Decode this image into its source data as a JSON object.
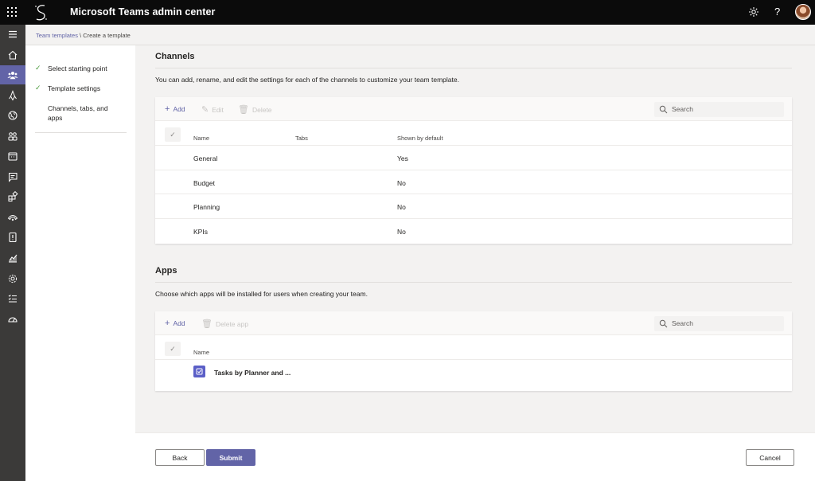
{
  "header": {
    "app_title": "Microsoft Teams admin center",
    "help_label": "?"
  },
  "breadcrumb": {
    "parent": "Team templates",
    "separator": " \\ ",
    "current": "Create a template"
  },
  "steps": [
    {
      "label": "Select starting point",
      "completed": true
    },
    {
      "label": "Template settings",
      "completed": true
    },
    {
      "label": "Channels, tabs, and apps",
      "completed": false
    }
  ],
  "channels": {
    "title": "Channels",
    "description": "You can add, rename, and edit the settings for each of the channels to customize your team template.",
    "toolbar": {
      "add": "Add",
      "edit": "Edit",
      "delete": "Delete",
      "search_placeholder": "Search"
    },
    "columns": [
      "Name",
      "Tabs",
      "Shown by default"
    ],
    "rows": [
      {
        "name": "General",
        "tabs": "",
        "shown": "Yes"
      },
      {
        "name": "Budget",
        "tabs": "",
        "shown": "No"
      },
      {
        "name": "Planning",
        "tabs": "",
        "shown": "No"
      },
      {
        "name": "KPIs",
        "tabs": "",
        "shown": "No"
      }
    ]
  },
  "apps": {
    "title": "Apps",
    "description": "Choose which apps will be installed for users when creating your team.",
    "toolbar": {
      "add": "Add",
      "delete": "Delete app",
      "search_placeholder": "Search"
    },
    "columns": [
      "Name"
    ],
    "rows": [
      {
        "name": "Tasks by Planner and ...",
        "icon": "planner-icon"
      }
    ]
  },
  "footer": {
    "back": "Back",
    "submit": "Submit",
    "cancel": "Cancel"
  },
  "rail_icons": [
    "menu-icon",
    "home-icon",
    "teams-icon",
    "deploy-icon",
    "globe-icon",
    "users-icon",
    "meetings-icon",
    "messaging-icon",
    "apps-icon",
    "voice-icon",
    "policy-icon",
    "analytics-icon",
    "settings-icon",
    "planning-icon",
    "dashboard-icon"
  ],
  "colors": {
    "accent": "#6264a7",
    "topbar": "#0b0b0b",
    "rail": "#3b3a39",
    "check": "#4a9b3c"
  }
}
